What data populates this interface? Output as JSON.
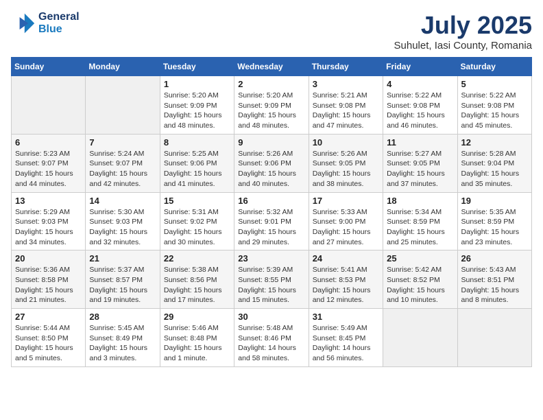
{
  "logo": {
    "line1": "General",
    "line2": "Blue"
  },
  "title": "July 2025",
  "location": "Suhulet, Iasi County, Romania",
  "days_header": [
    "Sunday",
    "Monday",
    "Tuesday",
    "Wednesday",
    "Thursday",
    "Friday",
    "Saturday"
  ],
  "weeks": [
    [
      {
        "day": "",
        "info": ""
      },
      {
        "day": "",
        "info": ""
      },
      {
        "day": "1",
        "info": "Sunrise: 5:20 AM\nSunset: 9:09 PM\nDaylight: 15 hours and 48 minutes."
      },
      {
        "day": "2",
        "info": "Sunrise: 5:20 AM\nSunset: 9:09 PM\nDaylight: 15 hours and 48 minutes."
      },
      {
        "day": "3",
        "info": "Sunrise: 5:21 AM\nSunset: 9:08 PM\nDaylight: 15 hours and 47 minutes."
      },
      {
        "day": "4",
        "info": "Sunrise: 5:22 AM\nSunset: 9:08 PM\nDaylight: 15 hours and 46 minutes."
      },
      {
        "day": "5",
        "info": "Sunrise: 5:22 AM\nSunset: 9:08 PM\nDaylight: 15 hours and 45 minutes."
      }
    ],
    [
      {
        "day": "6",
        "info": "Sunrise: 5:23 AM\nSunset: 9:07 PM\nDaylight: 15 hours and 44 minutes."
      },
      {
        "day": "7",
        "info": "Sunrise: 5:24 AM\nSunset: 9:07 PM\nDaylight: 15 hours and 42 minutes."
      },
      {
        "day": "8",
        "info": "Sunrise: 5:25 AM\nSunset: 9:06 PM\nDaylight: 15 hours and 41 minutes."
      },
      {
        "day": "9",
        "info": "Sunrise: 5:26 AM\nSunset: 9:06 PM\nDaylight: 15 hours and 40 minutes."
      },
      {
        "day": "10",
        "info": "Sunrise: 5:26 AM\nSunset: 9:05 PM\nDaylight: 15 hours and 38 minutes."
      },
      {
        "day": "11",
        "info": "Sunrise: 5:27 AM\nSunset: 9:05 PM\nDaylight: 15 hours and 37 minutes."
      },
      {
        "day": "12",
        "info": "Sunrise: 5:28 AM\nSunset: 9:04 PM\nDaylight: 15 hours and 35 minutes."
      }
    ],
    [
      {
        "day": "13",
        "info": "Sunrise: 5:29 AM\nSunset: 9:03 PM\nDaylight: 15 hours and 34 minutes."
      },
      {
        "day": "14",
        "info": "Sunrise: 5:30 AM\nSunset: 9:03 PM\nDaylight: 15 hours and 32 minutes."
      },
      {
        "day": "15",
        "info": "Sunrise: 5:31 AM\nSunset: 9:02 PM\nDaylight: 15 hours and 30 minutes."
      },
      {
        "day": "16",
        "info": "Sunrise: 5:32 AM\nSunset: 9:01 PM\nDaylight: 15 hours and 29 minutes."
      },
      {
        "day": "17",
        "info": "Sunrise: 5:33 AM\nSunset: 9:00 PM\nDaylight: 15 hours and 27 minutes."
      },
      {
        "day": "18",
        "info": "Sunrise: 5:34 AM\nSunset: 8:59 PM\nDaylight: 15 hours and 25 minutes."
      },
      {
        "day": "19",
        "info": "Sunrise: 5:35 AM\nSunset: 8:59 PM\nDaylight: 15 hours and 23 minutes."
      }
    ],
    [
      {
        "day": "20",
        "info": "Sunrise: 5:36 AM\nSunset: 8:58 PM\nDaylight: 15 hours and 21 minutes."
      },
      {
        "day": "21",
        "info": "Sunrise: 5:37 AM\nSunset: 8:57 PM\nDaylight: 15 hours and 19 minutes."
      },
      {
        "day": "22",
        "info": "Sunrise: 5:38 AM\nSunset: 8:56 PM\nDaylight: 15 hours and 17 minutes."
      },
      {
        "day": "23",
        "info": "Sunrise: 5:39 AM\nSunset: 8:55 PM\nDaylight: 15 hours and 15 minutes."
      },
      {
        "day": "24",
        "info": "Sunrise: 5:41 AM\nSunset: 8:53 PM\nDaylight: 15 hours and 12 minutes."
      },
      {
        "day": "25",
        "info": "Sunrise: 5:42 AM\nSunset: 8:52 PM\nDaylight: 15 hours and 10 minutes."
      },
      {
        "day": "26",
        "info": "Sunrise: 5:43 AM\nSunset: 8:51 PM\nDaylight: 15 hours and 8 minutes."
      }
    ],
    [
      {
        "day": "27",
        "info": "Sunrise: 5:44 AM\nSunset: 8:50 PM\nDaylight: 15 hours and 5 minutes."
      },
      {
        "day": "28",
        "info": "Sunrise: 5:45 AM\nSunset: 8:49 PM\nDaylight: 15 hours and 3 minutes."
      },
      {
        "day": "29",
        "info": "Sunrise: 5:46 AM\nSunset: 8:48 PM\nDaylight: 15 hours and 1 minute."
      },
      {
        "day": "30",
        "info": "Sunrise: 5:48 AM\nSunset: 8:46 PM\nDaylight: 14 hours and 58 minutes."
      },
      {
        "day": "31",
        "info": "Sunrise: 5:49 AM\nSunset: 8:45 PM\nDaylight: 14 hours and 56 minutes."
      },
      {
        "day": "",
        "info": ""
      },
      {
        "day": "",
        "info": ""
      }
    ]
  ]
}
